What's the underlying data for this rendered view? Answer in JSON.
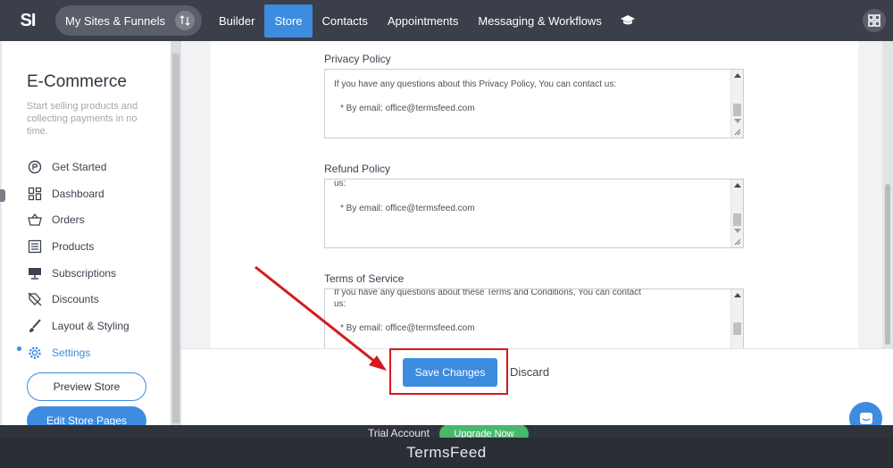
{
  "topbar": {
    "logo": "SI",
    "sites_button": "My Sites & Funnels",
    "nav": [
      "Builder",
      "Store",
      "Contacts",
      "Appointments",
      "Messaging & Workflows"
    ],
    "active_nav": "Store"
  },
  "sidebar": {
    "title": "E-Commerce",
    "description": "Start selling products and collecting payments in no time.",
    "items": [
      {
        "label": "Get Started",
        "icon": "get-started-icon"
      },
      {
        "label": "Dashboard",
        "icon": "dashboard-icon"
      },
      {
        "label": "Orders",
        "icon": "basket-icon"
      },
      {
        "label": "Products",
        "icon": "list-icon"
      },
      {
        "label": "Subscriptions",
        "icon": "monitor-icon"
      },
      {
        "label": "Discounts",
        "icon": "discount-tag-icon"
      },
      {
        "label": "Layout & Styling",
        "icon": "brush-icon"
      },
      {
        "label": "Settings",
        "icon": "gear-icon"
      }
    ],
    "active_item": "Settings",
    "preview_button": "Preview Store",
    "edit_button": "Edit Store Pages"
  },
  "form": {
    "privacy": {
      "label": "Privacy Policy",
      "line1": "If you have any questions about this Privacy Policy, You can contact us:",
      "line2": "* By email: office@termsfeed.com"
    },
    "refund": {
      "label": "Refund Policy",
      "line1": "us:",
      "line2": "* By email: office@termsfeed.com"
    },
    "terms": {
      "label": "Terms of Service",
      "line1": "If you have any questions about these Terms and Conditions, You can contact",
      "line2": "us:",
      "line3": "* By email: office@termsfeed.com"
    }
  },
  "actions": {
    "save": "Save Changes",
    "discard": "Discard"
  },
  "trial": {
    "text": "Trial Account",
    "upgrade": "Upgrade Now"
  },
  "footer": {
    "brand": "TermsFeed"
  },
  "colors": {
    "accent": "#3d8ce0",
    "topbar": "#3b3f4a",
    "highlight": "#d6191c",
    "upgrade": "#48b86c"
  }
}
